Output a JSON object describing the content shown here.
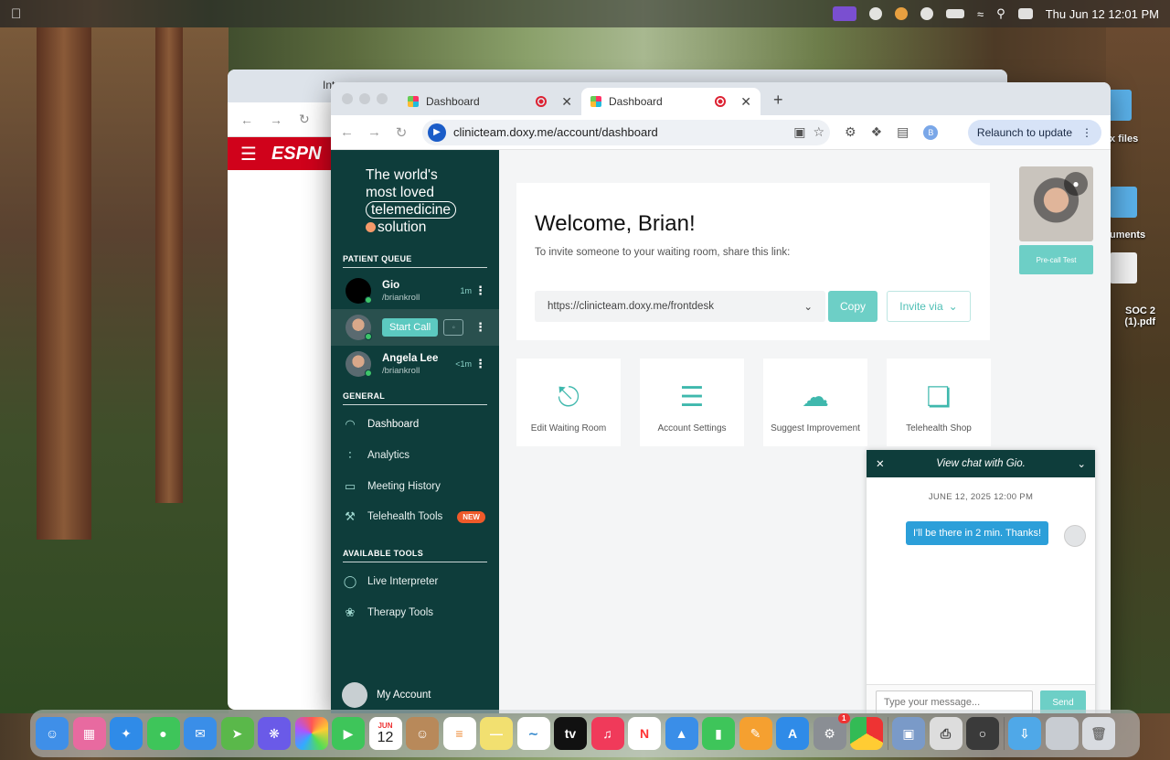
{
  "menubar": {
    "date_time": "Thu Jun 12  12:01 PM"
  },
  "back_window": {
    "tab_title": "Int",
    "espn": "ESPN"
  },
  "desktop": {
    "label1": "x files",
    "label2": "uments",
    "label3": "SOC 2 (1).pdf"
  },
  "browser": {
    "tabs": [
      {
        "title": "Dashboard"
      },
      {
        "title": "Dashboard"
      }
    ],
    "url": "clinicteam.doxy.me/account/dashboard",
    "profile_initial": "B",
    "relaunch_label": "Relaunch to update"
  },
  "sidebar": {
    "logo": {
      "line1": "The world's",
      "line2": "most loved",
      "line3": "telemedicine",
      "line4": "solution"
    },
    "patient_queue_title": "PATIENT QUEUE",
    "patients": [
      {
        "name": "Gio",
        "room": "/briankroll",
        "time": "1m"
      },
      {
        "start_call": "Start Call"
      },
      {
        "name": "Angela Lee",
        "room": "/briankroll",
        "time": "<1m"
      }
    ],
    "general_title": "GENERAL",
    "general": [
      {
        "label": "Dashboard",
        "icon": "gauge-icon"
      },
      {
        "label": "Analytics",
        "icon": "chart-icon"
      },
      {
        "label": "Meeting History",
        "icon": "history-icon"
      },
      {
        "label": "Telehealth Tools",
        "icon": "tools-icon",
        "badge": "NEW"
      }
    ],
    "available_title": "AVAILABLE TOOLS",
    "available": [
      {
        "label": "Live Interpreter",
        "icon": "globe-icon"
      },
      {
        "label": "Therapy Tools",
        "icon": "leaf-icon"
      }
    ],
    "my_account": "My Account"
  },
  "main": {
    "welcome": "Welcome, Brian!",
    "invite_text": "To invite someone to your waiting room, share this link:",
    "room_link": "https://clinicteam.doxy.me/frontdesk",
    "copy_label": "Copy",
    "invite_label": "Invite via",
    "tiles": [
      {
        "label": "Edit Waiting Room",
        "icon": "chair-icon"
      },
      {
        "label": "Account Settings",
        "icon": "sliders-icon"
      },
      {
        "label": "Suggest Improvement",
        "icon": "chat-bubbles-icon"
      },
      {
        "label": "Telehealth Shop",
        "icon": "cart-icon"
      }
    ],
    "precall_label": "Pre-call Test"
  },
  "chat": {
    "title": "View chat with Gio.",
    "date": "JUNE 12, 2025 12:00 PM",
    "message": "I'll be there in 2 min. Thanks!",
    "placeholder": "Type your message...",
    "send_label": "Send"
  },
  "dock": {
    "calendar_month": "JUN",
    "calendar_day": "12",
    "settings_badge": "1"
  }
}
